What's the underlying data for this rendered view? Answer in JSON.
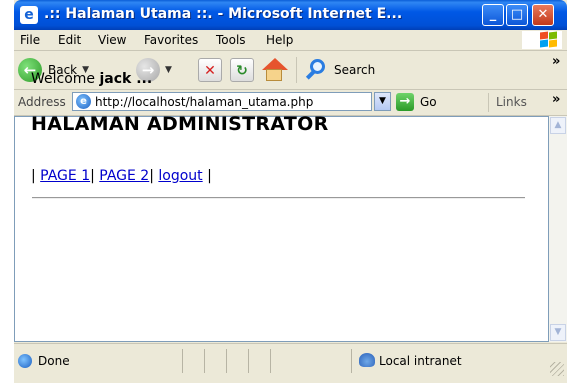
{
  "window": {
    "title": ".:: Halaman Utama ::. - Microsoft Internet E...",
    "icon": "ie-page-icon"
  },
  "titlebar_buttons": {
    "minimize": "_",
    "maximize": "□",
    "close": "✕"
  },
  "menu": {
    "items": [
      {
        "label": "File",
        "accel": "F"
      },
      {
        "label": "Edit",
        "accel": "E"
      },
      {
        "label": "View",
        "accel": "V"
      },
      {
        "label": "Favorites",
        "accel": "a"
      },
      {
        "label": "Tools",
        "accel": "T"
      },
      {
        "label": "Help",
        "accel": "H"
      }
    ]
  },
  "toolbar": {
    "back_label": "Back",
    "search_label": "Search",
    "more": "»"
  },
  "address": {
    "label": "Address",
    "url": "http://localhost/halaman_utama.php",
    "go_label": "Go",
    "links_label": "Links",
    "more": "»"
  },
  "page": {
    "welcome_prefix": "Welcome ",
    "username": "jack ...",
    "heading": "HALAMAN ADMINISTRATOR",
    "links": [
      {
        "label": "PAGE 1"
      },
      {
        "label": "PAGE 2"
      },
      {
        "label": "logout"
      }
    ],
    "separator": "|"
  },
  "status": {
    "text": "Done",
    "zone": "Local intranet"
  },
  "colors": {
    "titlebar": "#0058e6",
    "link": "#0000cc",
    "chrome": "#ece9d8"
  }
}
